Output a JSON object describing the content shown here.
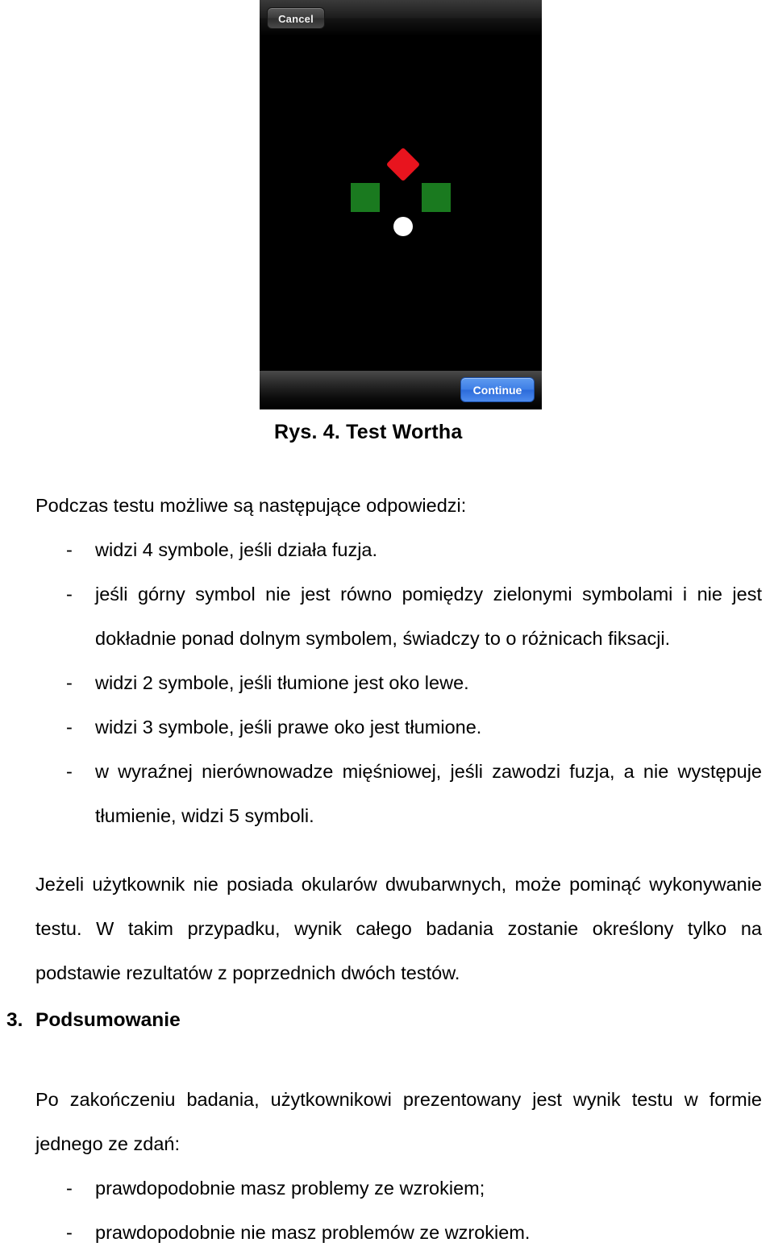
{
  "figure": {
    "phone": {
      "cancel_label": "Cancel",
      "continue_label": "Continue",
      "stage_background": "#000000",
      "symbols": [
        {
          "name": "diamond",
          "color": "#e8141e",
          "position": "top"
        },
        {
          "name": "cross",
          "color": "#1a7a1f",
          "position": "left"
        },
        {
          "name": "cross",
          "color": "#1a7a1f",
          "position": "right"
        },
        {
          "name": "circle",
          "color": "#ffffff",
          "position": "bottom"
        }
      ]
    },
    "caption": "Rys. 4. Test Wortha"
  },
  "content": {
    "lead_paragraph": "Podczas testu możliwe są następujące odpowiedzi:",
    "bullet_marker": "-",
    "answers": [
      "widzi 4 symbole, jeśli działa fuzja.",
      "jeśli górny symbol nie jest równo pomiędzy zielonymi symbolami i nie jest dokładnie ponad dolnym symbolem, świadczy to o różnicach fiksacji.",
      "widzi 2 symbole, jeśli tłumione jest oko lewe.",
      "widzi 3 symbole, jeśli prawe oko jest tłumione.",
      "w wyraźnej nierównowadze mięśniowej, jeśli zawodzi fuzja, a nie występuje tłumienie, widzi 5 symboli."
    ],
    "note_paragraph": "Jeżeli użytkownik nie posiada okularów dwubarwnych, może pominąć wykonywanie testu. W takim przypadku, wynik całego badania zostanie określony tylko na podstawie rezultatów z poprzednich dwóch testów."
  },
  "section": {
    "number": "3.",
    "title": "Podsumowanie",
    "intro_paragraph": "Po zakończeniu badania, użytkownikowi prezentowany jest wynik testu w formie jednego ze zdań:",
    "bullet_marker": "-",
    "results": [
      "prawdopodobnie masz problemy ze wzrokiem;",
      "prawdopodobnie nie masz problemów ze wzrokiem."
    ]
  }
}
